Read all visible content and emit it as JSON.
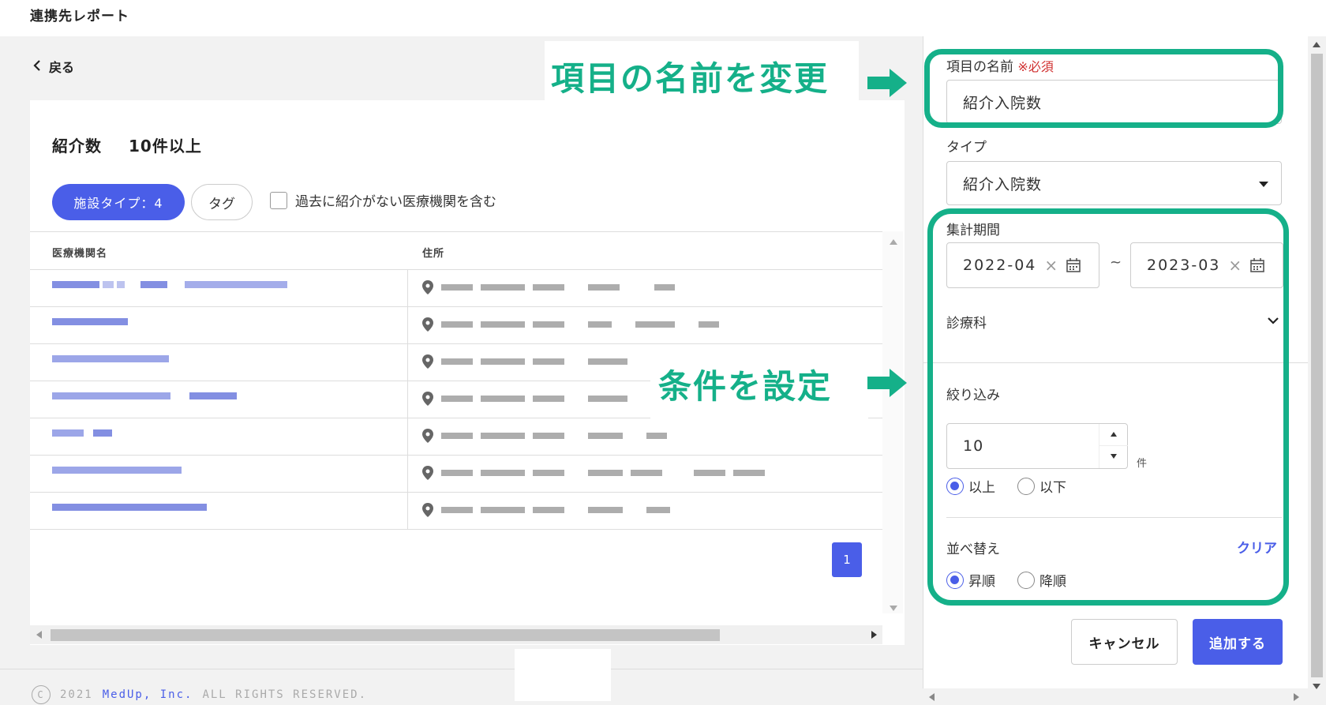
{
  "header": {
    "title": "連携先レポート"
  },
  "nav": {
    "back_label": "戻る"
  },
  "card": {
    "title": "紹介数",
    "condition": "10件以上",
    "facility_type_filter": "施設タイプ：4",
    "tag_filter": "タグ",
    "include_past_label": "過去に紹介がない医療機関を含む"
  },
  "table": {
    "columns": [
      "医療機関名",
      "住所"
    ],
    "row_count_visible": 7
  },
  "pagination": {
    "current_page": "1"
  },
  "annotations": {
    "rename": "項目の名前を変更",
    "conditions": "条件を設定"
  },
  "panel": {
    "item_name_label": "項目の名前",
    "required_mark": "※必須",
    "item_name_value": "紹介入院数",
    "type_label": "タイプ",
    "type_value": "紹介入院数",
    "period_label": "集計期間",
    "period_start": "2022-04",
    "period_end": "2023-03",
    "period_sep": "~",
    "department_label": "診療科",
    "filter_label": "絞り込み",
    "filter_value": "10",
    "filter_unit": "件",
    "filter_options": [
      "以上",
      "以下"
    ],
    "filter_selected": "以上",
    "sort_label": "並べ替え",
    "sort_clear": "クリア",
    "sort_options": [
      "昇順",
      "降順"
    ],
    "sort_selected": "昇順",
    "cancel_label": "キャンセル",
    "add_label": "追加する"
  },
  "footer": {
    "year": "2021",
    "company": "MedUp, Inc.",
    "rights": "ALL RIGHTS RESERVED."
  },
  "colors": {
    "accent": "#4a5ee8",
    "annotation": "#15b089",
    "required": "#d03030"
  }
}
